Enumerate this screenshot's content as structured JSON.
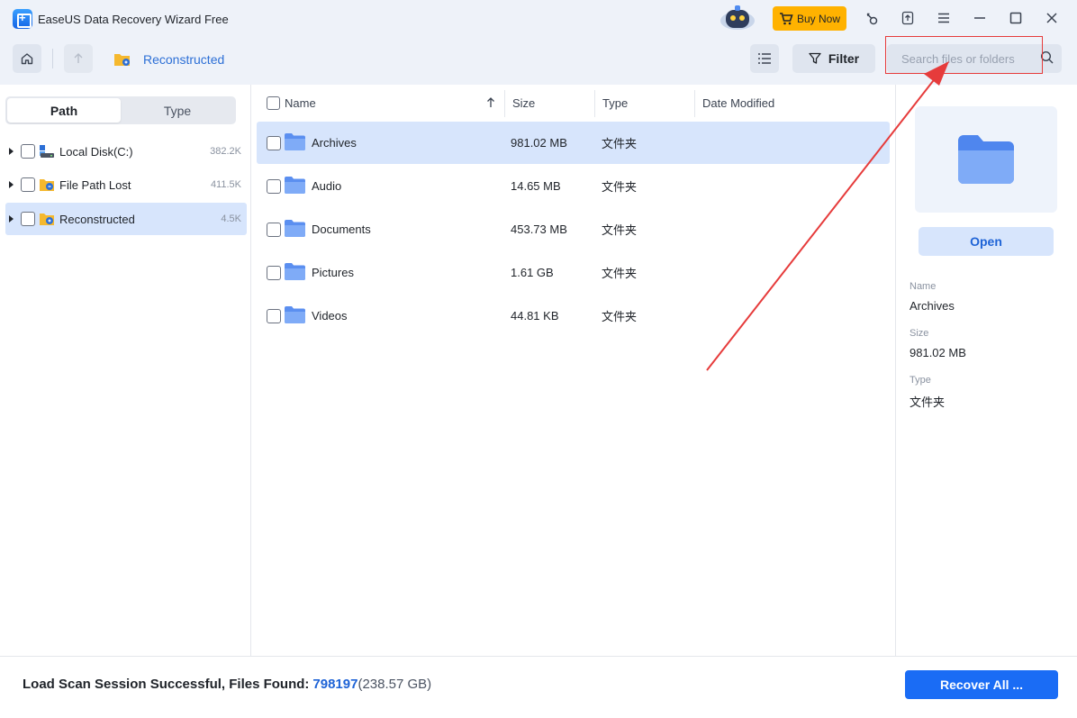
{
  "window": {
    "title": "EaseUS Data Recovery Wizard Free",
    "buy_now_label": "Buy Now"
  },
  "toolbar": {
    "breadcrumb_label": "Reconstructed",
    "filter_label": "Filter",
    "search_placeholder": "Search files or folders"
  },
  "sidebar": {
    "tabs": [
      {
        "label": "Path",
        "active": true
      },
      {
        "label": "Type",
        "active": false
      }
    ],
    "tree": [
      {
        "label": "Local Disk(C:)",
        "count": "382.2K",
        "icon": "disk-icon",
        "selected": false
      },
      {
        "label": "File Path Lost",
        "count": "411.5K",
        "icon": "lost-folder-icon",
        "selected": false
      },
      {
        "label": "Reconstructed",
        "count": "4.5K",
        "icon": "reconstructed-folder-icon",
        "selected": true
      }
    ]
  },
  "file_list": {
    "columns": [
      "Name",
      "Size",
      "Type",
      "Date Modified"
    ],
    "rows": [
      {
        "name": "Archives",
        "size": "981.02 MB",
        "type": "文件夹",
        "selected": true
      },
      {
        "name": "Audio",
        "size": "14.65 MB",
        "type": "文件夹",
        "selected": false
      },
      {
        "name": "Documents",
        "size": "453.73 MB",
        "type": "文件夹",
        "selected": false
      },
      {
        "name": "Pictures",
        "size": "1.61 GB",
        "type": "文件夹",
        "selected": false
      },
      {
        "name": "Videos",
        "size": "44.81 KB",
        "type": "文件夹",
        "selected": false
      }
    ]
  },
  "details": {
    "open_label": "Open",
    "name_label": "Name",
    "name_value": "Archives",
    "size_label": "Size",
    "size_value": "981.02 MB",
    "type_label": "Type",
    "type_value": "文件夹"
  },
  "footer": {
    "status_text": "Load Scan Session Successful, Files Found:",
    "files_found": "798197",
    "total_size": "(238.57 GB)",
    "recover_label": "Recover All ..."
  },
  "colors": {
    "accent": "#1a6cf5",
    "selection": "#d7e5fc",
    "buy_now": "#ffb200",
    "annotation": "#e63b3b"
  }
}
